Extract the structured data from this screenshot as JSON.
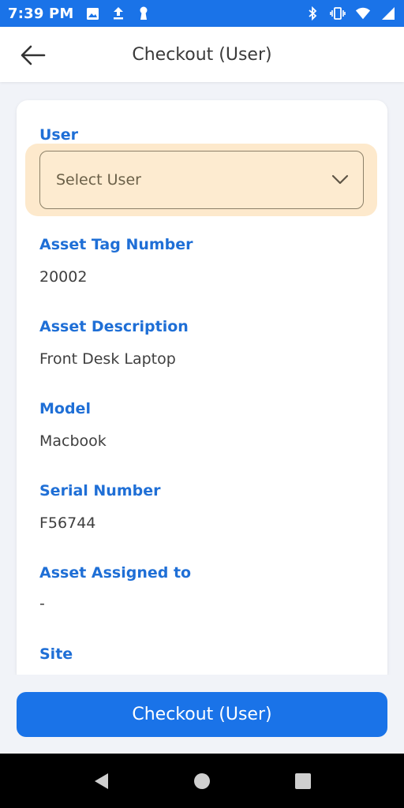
{
  "status_bar": {
    "time": "7:39 PM",
    "left_icons": [
      "image-icon",
      "upload-icon",
      "keyhole-icon"
    ],
    "right_icons": [
      "bluetooth-icon",
      "vibrate-icon",
      "wifi-icon",
      "signal-icon"
    ]
  },
  "app_bar": {
    "title": "Checkout (User)",
    "back_icon": "arrow-left-icon"
  },
  "form": {
    "user_label": "User",
    "user_select_placeholder": "Select User",
    "fields": [
      {
        "label": "Asset Tag Number",
        "value": "20002"
      },
      {
        "label": "Asset Description",
        "value": "Front Desk Laptop"
      },
      {
        "label": "Model",
        "value": "Macbook"
      },
      {
        "label": "Serial Number",
        "value": "F56744"
      },
      {
        "label": "Asset Assigned to",
        "value": "-"
      },
      {
        "label": "Site",
        "value": ""
      }
    ]
  },
  "actions": {
    "checkout_label": "Checkout (User)"
  },
  "colors": {
    "accent": "#1a73e8",
    "label_blue": "#1f6fd6",
    "select_highlight": "#fde9cc"
  }
}
